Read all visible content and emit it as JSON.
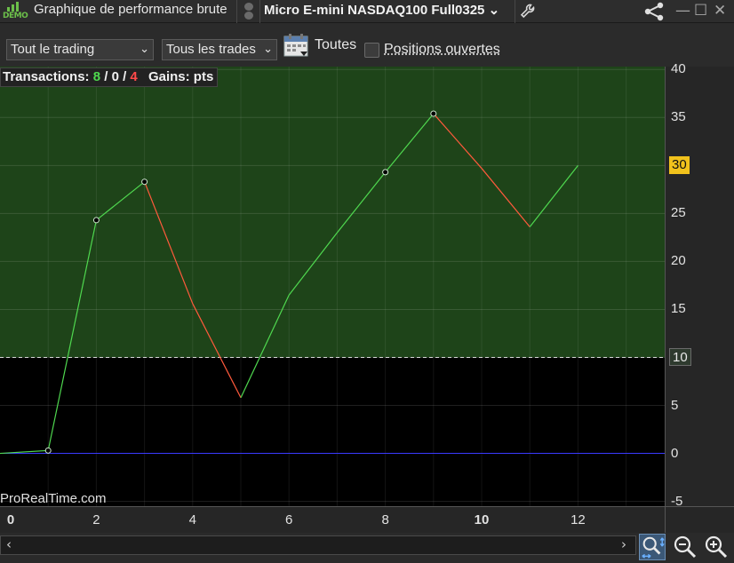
{
  "window": {
    "logo_text": "DEMO",
    "title": "Graphique de performance brute",
    "instrument": "Micro E-mini NASDAQ100 Full0325",
    "instrument_chevron_icon": "chevron-down-icon",
    "settings_icon": "wrench-icon",
    "share_icon": "share-icon",
    "minimize_label": "—",
    "maximize_label": "☐",
    "close_label": "✕"
  },
  "toolbar": {
    "scope_select": "Tout le trading",
    "trades_select": "Tous les trades",
    "period_label": "Toutes",
    "open_positions_label": "Positions ouvertes",
    "open_positions_checked": false
  },
  "summary": {
    "transactions_label": "Transactions:",
    "winning": "8",
    "sep1": "/",
    "neutral": "0",
    "sep2": "/",
    "losing": "4",
    "gains_label": "Gains: pts"
  },
  "watermark": "ProRealTime.com",
  "colors": {
    "up": "#4fd84f",
    "down": "#ff5a3c",
    "zero_line": "#3a3aff",
    "area_above_threshold": "#1e4419",
    "threshold_tag": "#f1c21c"
  },
  "chart_data": {
    "type": "line",
    "x": [
      0,
      1,
      2,
      3,
      4,
      5,
      6,
      7,
      8,
      9,
      10,
      11,
      12
    ],
    "y": [
      0,
      0.3,
      24.3,
      28.3,
      15.6,
      5.8,
      16.5,
      23.0,
      29.3,
      35.4,
      29.7,
      23.6,
      30.0
    ],
    "markers": [
      1,
      2,
      3,
      8,
      9
    ],
    "xlim": [
      0,
      13.8
    ],
    "ylim": [
      -5.5,
      40.3
    ],
    "x_ticks": [
      0,
      2,
      4,
      6,
      8,
      10,
      12
    ],
    "x_ticks_bold": [
      0,
      10
    ],
    "y_ticks": [
      -5,
      0,
      5,
      15,
      20,
      25,
      35,
      40
    ],
    "threshold": 10,
    "last_value": 30,
    "threshold_label": "10",
    "last_value_label": "30",
    "grid": true
  },
  "zoom": {
    "auto_icon": "zoom-auto-icon",
    "out_icon": "zoom-out-icon",
    "in_icon": "zoom-in-icon",
    "left_arrow": "‹",
    "right_arrow": "›"
  }
}
